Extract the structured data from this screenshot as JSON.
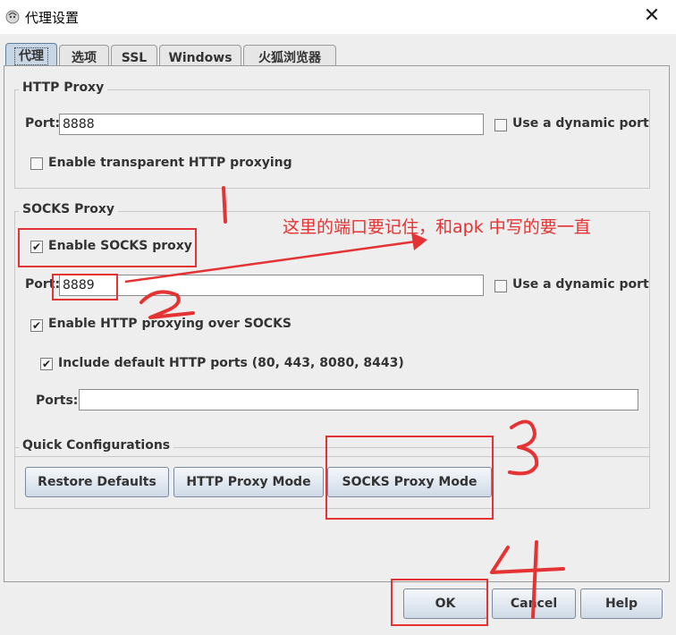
{
  "window": {
    "title": "代理设置",
    "close_glyph": "✕"
  },
  "tabs": [
    {
      "label": "代理",
      "active": true
    },
    {
      "label": "选项"
    },
    {
      "label": "SSL"
    },
    {
      "label": "Windows"
    },
    {
      "label": "火狐浏览器"
    }
  ],
  "http_proxy": {
    "legend": "HTTP Proxy",
    "port_label": "Port:",
    "port_value": "8888",
    "dynamic_port_label": "Use a dynamic port",
    "dynamic_port_checked": false,
    "transparent_label": "Enable transparent HTTP proxying",
    "transparent_checked": false
  },
  "socks_proxy": {
    "legend": "SOCKS Proxy",
    "enable_label": "Enable SOCKS proxy",
    "enable_checked": true,
    "port_label": "Port:",
    "port_value": "8889",
    "dynamic_port_label": "Use a dynamic port",
    "dynamic_port_checked": false,
    "http_over_socks_label": "Enable HTTP proxying over SOCKS",
    "http_over_socks_checked": true,
    "default_ports_label": "Include default HTTP ports (80, 443, 8080, 8443)",
    "default_ports_checked": true,
    "ports_label": "Ports:",
    "ports_value": ""
  },
  "quick_config": {
    "legend": "Quick Configurations",
    "restore_label": "Restore Defaults",
    "http_mode_label": "HTTP Proxy Mode",
    "socks_mode_label": "SOCKS Proxy Mode"
  },
  "footer": {
    "ok_label": "OK",
    "cancel_label": "Cancel",
    "help_label": "Help"
  },
  "annotations": {
    "note": "这里的端口要记住，和apk 中写的要一直",
    "numbers": [
      "1",
      "2",
      "3",
      "4"
    ],
    "color": "#e53333"
  },
  "check_glyph": "✔"
}
